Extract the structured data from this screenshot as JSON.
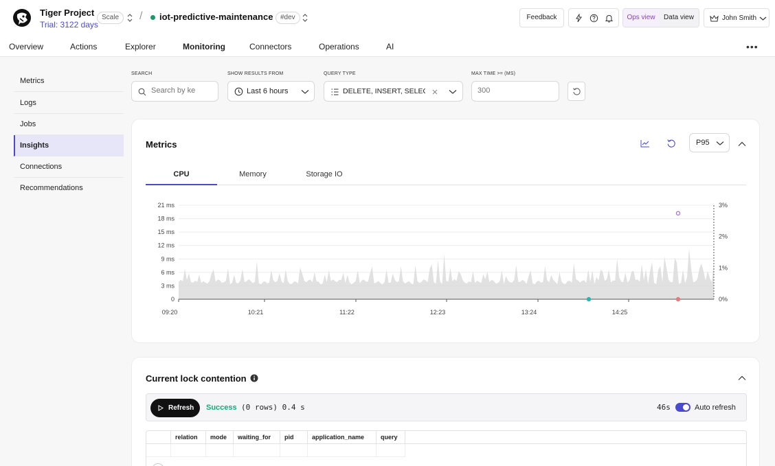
{
  "header": {
    "project_title": "Tiger Project",
    "trial": "Trial: 3122 days",
    "plan_badge": "Scale",
    "service_name": "iot-predictive-maintenance",
    "env_badge": "#dev",
    "feedback": "Feedback",
    "ops_view": "Ops view",
    "data_view": "Data view",
    "user_name": "John Smith"
  },
  "nav": {
    "tabs": [
      "Overview",
      "Actions",
      "Explorer",
      "Monitoring",
      "Connectors",
      "Operations",
      "AI"
    ],
    "active": "Monitoring"
  },
  "sidebar": {
    "items": [
      "Metrics",
      "Logs",
      "Jobs",
      "Insights",
      "Connections",
      "Recommendations"
    ],
    "active": "Insights"
  },
  "filters": {
    "search_label": "SEARCH",
    "search_placeholder": "Search by ke",
    "results_label": "SHOW RESULTS FROM",
    "results_value": "Last 6 hours",
    "query_type_label": "QUERY TYPE",
    "query_type_value": "DELETE, INSERT, SELEC",
    "max_time_label": "MAX TIME >= (MS)",
    "max_time_placeholder": "300"
  },
  "metrics": {
    "title": "Metrics",
    "percentile": "P95",
    "tabs": [
      "CPU",
      "Memory",
      "Storage IO"
    ],
    "active_tab": "CPU"
  },
  "chart_data": {
    "type": "area",
    "y_ticks": [
      "0",
      "3 ms",
      "6 ms",
      "9 ms",
      "12 ms",
      "15 ms",
      "18 ms",
      "21 ms"
    ],
    "y2_ticks": [
      "0%",
      "1%",
      "2%",
      "3%"
    ],
    "x_ticks": [
      "09:20",
      "10:21",
      "11:22",
      "12:23",
      "13:24",
      "14:25"
    ],
    "ylim": [
      0,
      21
    ],
    "y2lim": [
      0,
      3
    ],
    "grid": true,
    "colors": {
      "area": "#dcdcdc",
      "point_purple": "#a06ae0",
      "point_teal": "#2bb5b0",
      "point_red": "#e57a7a"
    },
    "points": [
      {
        "x": "13:57",
        "y": 0,
        "color": "teal"
      },
      {
        "x": "14:56",
        "y": 0,
        "color": "red"
      },
      {
        "x": "14:56",
        "y": 19.2,
        "color": "purple"
      }
    ]
  },
  "locks": {
    "title": "Current lock contention",
    "refresh": "Refresh",
    "status": "Success",
    "rows_info": "(0 rows) 0.4 s",
    "timer": "46s",
    "auto_refresh": "Auto refresh",
    "columns": [
      "relation",
      "mode",
      "waiting_for",
      "pid",
      "application_name",
      "query"
    ]
  }
}
